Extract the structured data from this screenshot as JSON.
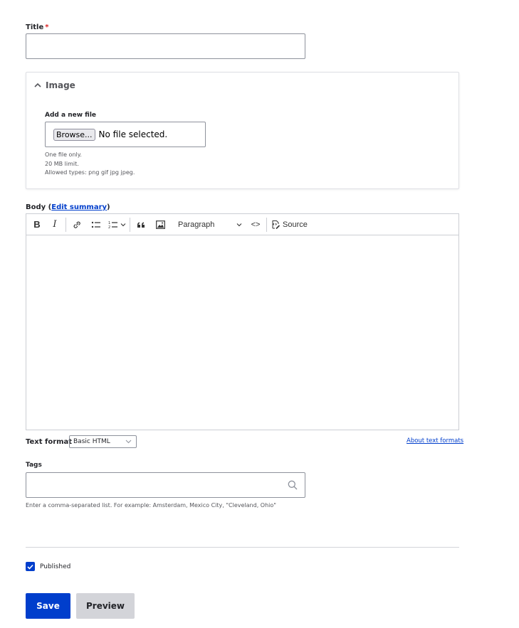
{
  "title_field": {
    "label": "Title",
    "required_marker": "*",
    "value": ""
  },
  "image_group": {
    "summary": "Image",
    "add_label": "Add a new file",
    "browse_label": "Browse...",
    "file_status": "No file selected.",
    "help": [
      "One file only.",
      "20 MB limit.",
      "Allowed types: png gif jpg jpeg."
    ]
  },
  "body_field": {
    "label": "Body",
    "edit_summary_open": "(",
    "edit_summary_link": "Edit summary",
    "edit_summary_close": ")",
    "toolbar": {
      "bold": "B",
      "italic": "I",
      "heading_select": "Paragraph",
      "code_block": "<>",
      "source_label": "Source"
    },
    "value": ""
  },
  "text_format": {
    "label": "Text format",
    "selected": "Basic HTML",
    "about_link": "About text formats"
  },
  "tags_field": {
    "label": "Tags",
    "value": "",
    "help": "Enter a comma-separated list. For example: Amsterdam, Mexico City, \"Cleveland, Ohio\""
  },
  "published": {
    "label": "Published",
    "checked": true
  },
  "actions": {
    "save": "Save",
    "preview": "Preview"
  },
  "colors": {
    "accent": "#003ecc",
    "required": "#dc2323"
  }
}
